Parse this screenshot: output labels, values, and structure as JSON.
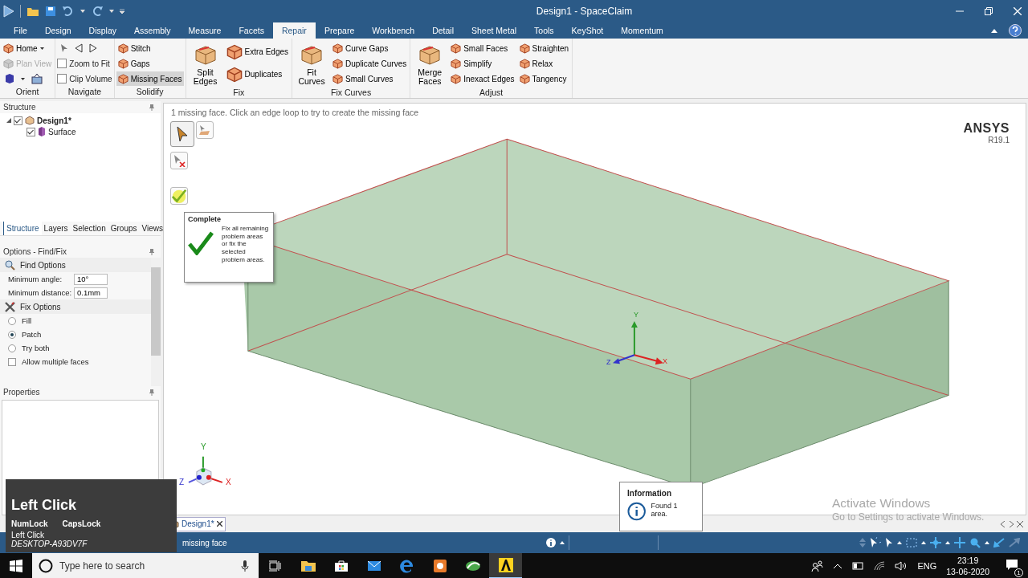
{
  "title_bar": {
    "title": "Design1 - SpaceClaim"
  },
  "ribbon_tabs": [
    {
      "label": "File",
      "selected": false
    },
    {
      "label": "Design",
      "selected": false
    },
    {
      "label": "Display",
      "selected": false
    },
    {
      "label": "Assembly",
      "selected": false
    },
    {
      "label": "Measure",
      "selected": false
    },
    {
      "label": "Facets",
      "selected": false
    },
    {
      "label": "Repair",
      "selected": true
    },
    {
      "label": "Prepare",
      "selected": false
    },
    {
      "label": "Workbench",
      "selected": false
    },
    {
      "label": "Detail",
      "selected": false
    },
    {
      "label": "Sheet Metal",
      "selected": false
    },
    {
      "label": "Tools",
      "selected": false
    },
    {
      "label": "KeyShot",
      "selected": false
    },
    {
      "label": "Momentum",
      "selected": false
    }
  ],
  "ribbon_groups": [
    {
      "label": "Orient",
      "columns": [
        [
          {
            "kind": "menu",
            "label": "Home",
            "selected": false,
            "disabled": false
          },
          {
            "kind": "small",
            "label": "Plan View",
            "selected": false,
            "disabled": true
          },
          {
            "kind": "orient-icons"
          }
        ]
      ]
    },
    {
      "label": "Navigate",
      "columns": [
        [
          {
            "kind": "nav-icons"
          },
          {
            "kind": "check",
            "label": "Zoom to Fit",
            "checked": false
          },
          {
            "kind": "check",
            "label": "Clip Volume",
            "checked": false
          }
        ]
      ]
    },
    {
      "label": "Solidify",
      "columns": [
        [
          {
            "kind": "small",
            "label": "Stitch",
            "selected": false,
            "disabled": false
          },
          {
            "kind": "small",
            "label": "Gaps",
            "selected": false,
            "disabled": false
          },
          {
            "kind": "small",
            "label": "Missing Faces",
            "selected": true,
            "disabled": false
          }
        ]
      ]
    },
    {
      "label": "Fix",
      "columns": [
        [
          {
            "kind": "large",
            "label": "Split Edges",
            "selected": false,
            "disabled": false
          }
        ],
        [
          {
            "kind": "medium",
            "label": "Extra Edges",
            "selected": false,
            "disabled": false
          },
          {
            "kind": "medium",
            "label": "Duplicates",
            "selected": false,
            "disabled": false
          }
        ]
      ]
    },
    {
      "label": "Fix Curves",
      "columns": [
        [
          {
            "kind": "large",
            "label": "Fit Curves",
            "selected": false,
            "disabled": false
          }
        ],
        [
          {
            "kind": "small",
            "label": "Curve Gaps",
            "selected": false,
            "disabled": false
          },
          {
            "kind": "small",
            "label": "Duplicate Curves",
            "selected": false,
            "disabled": false
          },
          {
            "kind": "small",
            "label": "Small Curves",
            "selected": false,
            "disabled": false
          }
        ]
      ]
    },
    {
      "label": "Adjust",
      "columns": [
        [
          {
            "kind": "large",
            "label": "Merge Faces",
            "selected": false,
            "disabled": false
          }
        ],
        [
          {
            "kind": "small",
            "label": "Small Faces",
            "selected": false,
            "disabled": false
          },
          {
            "kind": "small",
            "label": "Simplify",
            "selected": false,
            "disabled": false
          },
          {
            "kind": "small",
            "label": "Inexact Edges",
            "selected": false,
            "disabled": false
          }
        ],
        [
          {
            "kind": "small",
            "label": "Straighten",
            "selected": false,
            "disabled": false
          },
          {
            "kind": "small",
            "label": "Relax",
            "selected": false,
            "disabled": false
          },
          {
            "kind": "small",
            "label": "Tangency",
            "selected": false,
            "disabled": false
          }
        ]
      ]
    }
  ],
  "structure_panel": {
    "title": "Structure",
    "tree": [
      {
        "label": "Design1*",
        "checked": true,
        "expanded": true,
        "children": [
          {
            "label": "Surface",
            "checked": true
          }
        ]
      }
    ]
  },
  "panel_tabs": [
    {
      "label": "Structure",
      "selected": true
    },
    {
      "label": "Layers",
      "selected": false
    },
    {
      "label": "Selection",
      "selected": false
    },
    {
      "label": "Groups",
      "selected": false
    },
    {
      "label": "Views",
      "selected": false
    }
  ],
  "options_panel": {
    "title": "Options - Find/Fix",
    "sections": [
      {
        "kind": "find",
        "title": "Find Options",
        "fields": [
          {
            "label": "Minimum angle:",
            "value": "10°"
          },
          {
            "label": "Minimum distance:",
            "value": "0.1mm"
          }
        ]
      },
      {
        "kind": "fix",
        "title": "Fix Options",
        "options": [
          {
            "kind": "radio",
            "label": "Fill",
            "selected": false
          },
          {
            "kind": "radio",
            "label": "Patch",
            "selected": true
          },
          {
            "kind": "radio",
            "label": "Try both",
            "selected": false
          },
          {
            "kind": "check",
            "label": "Allow multiple faces",
            "checked": false
          }
        ]
      }
    ]
  },
  "properties_panel": {
    "title": "Properties"
  },
  "viewport": {
    "hint": "1 missing face. Click an edge loop to try to create the missing face",
    "logo": "ANSYS",
    "version": "R19.1",
    "tools": [
      {
        "kind": "select",
        "selected": true
      },
      {
        "kind": "select-face",
        "selected": false
      },
      {
        "kind": "exclude",
        "selected": false
      },
      {
        "kind": "complete",
        "selected": false
      }
    ],
    "model_triad": {
      "x": "X",
      "y": "Y",
      "z": "Z"
    },
    "view_triad": {
      "x": "X",
      "y": "Y",
      "z": "Z"
    }
  },
  "tooltip": {
    "title": "Complete",
    "text": "Fix all remaining problem areas or fix the selected problem areas."
  },
  "document_tabs": [
    {
      "label": "Design1*",
      "selected": true
    }
  ],
  "info_popup": {
    "title": "Information",
    "text": "Found 1 area."
  },
  "status_bar": {
    "text": "missing face"
  },
  "activation_notice": {
    "title": "Activate Windows",
    "text": "Go to Settings to activate Windows."
  },
  "key_overlay": {
    "action": "Left Click",
    "keys": [
      "NumLock",
      "CapsLock"
    ],
    "last": "Left Click",
    "host": "DESKTOP-A93DV7F"
  },
  "taskbar": {
    "search_placeholder": "Type here to search",
    "apps": [
      {
        "kind": "task-view",
        "selected": false
      },
      {
        "kind": "folder",
        "selected": false
      },
      {
        "kind": "store",
        "selected": false
      },
      {
        "kind": "mail",
        "selected": false
      },
      {
        "kind": "edge",
        "selected": false
      },
      {
        "kind": "orange-app",
        "selected": false
      },
      {
        "kind": "green-app",
        "selected": false
      },
      {
        "kind": "ansys",
        "selected": true
      }
    ],
    "language": "ENG",
    "time": "23:19",
    "date": "13-06-2020",
    "notifications": "1"
  }
}
